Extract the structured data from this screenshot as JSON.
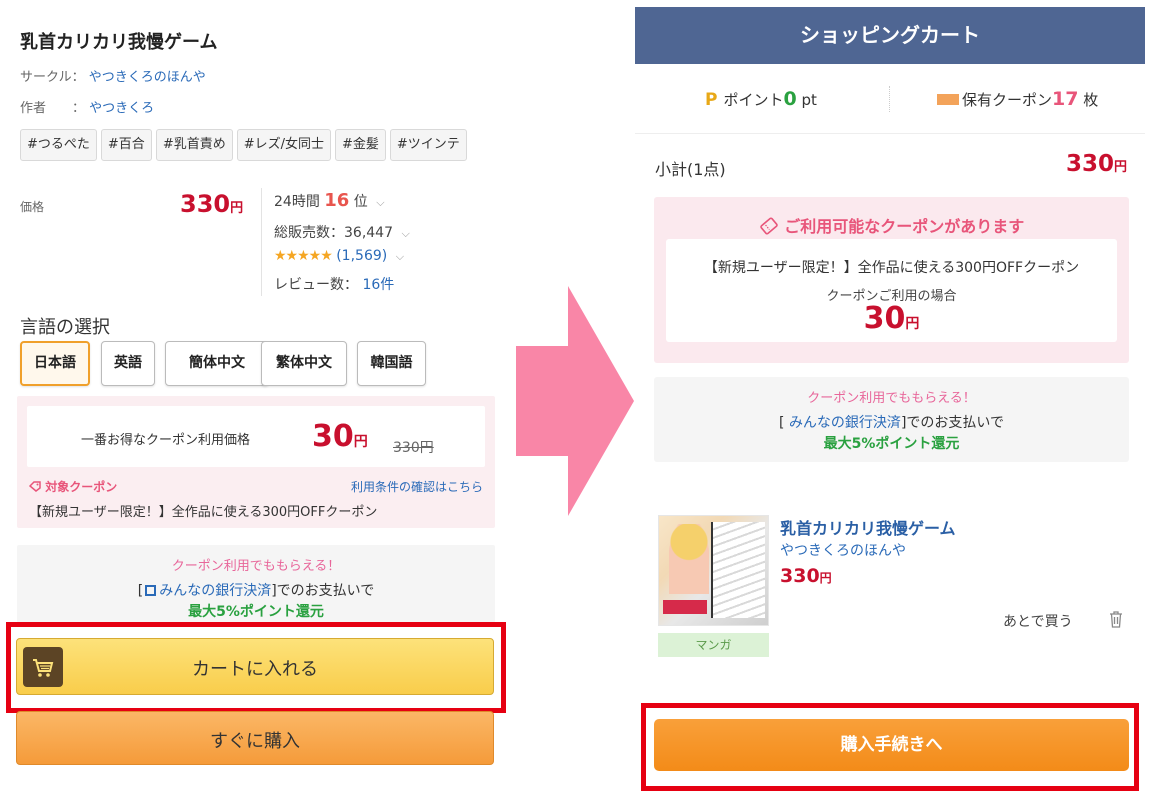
{
  "product": {
    "title": "乳首カリカリ我慢ゲーム",
    "circle_label": "サークル：",
    "circle": "やつきくろのほんや",
    "author_label": "作者　　：",
    "author": "やつきくろ",
    "tags": [
      "#つるぺた",
      "#百合",
      "#乳首責め",
      "#レズ/女同士",
      "#金髪",
      "#ツインテ"
    ],
    "price_label": "価格",
    "price": "330",
    "currency": "円",
    "rank_prefix": "24時間",
    "rank": "16",
    "rank_suffix": "位",
    "sales_text": "総販売数：36,447",
    "stars": "★★★★★",
    "rating_count": "(1,569)",
    "review_label": "レビュー数：",
    "review_count": "16件"
  },
  "language": {
    "heading": "言語の選択",
    "options": [
      "日本語",
      "英語",
      "簡体中文",
      "繁体中文",
      "韓国語"
    ],
    "selected": "日本語"
  },
  "coupon_left": {
    "label": "一番お得なクーポン利用価格",
    "price": "30",
    "currency": "円",
    "original": "330円",
    "target": "対象クーポン",
    "terms_link": "利用条件の確認はこちら",
    "description": "【新規ユーザー限定！】全作品に使える300円OFFクーポン"
  },
  "bank": {
    "line1": "クーポン利用でももらえる！",
    "bracket_open": "[",
    "bank_name": "みんなの銀行決済",
    "line2_suffix": "]でのお支払いで",
    "line3": "最大5%ポイント還元"
  },
  "buttons": {
    "add_to_cart": "カートに入れる",
    "buy_now": "すぐに購入"
  },
  "cart": {
    "header": "ショッピングカート",
    "points_prefix": "ポイント",
    "points_value": "0",
    "points_unit": "pt",
    "coupons_prefix": "保有クーポン",
    "coupons_value": "17",
    "coupons_unit": "枚",
    "subtotal_label": "小計(1点)",
    "subtotal": "330",
    "currency": "円",
    "coupon_available": "ご利用可能なクーポンがあります",
    "coupon_desc": "【新規ユーザー限定！】全作品に使える300円OFFクーポン",
    "coupon_use_label": "クーポンご利用の場合",
    "coupon_price": "30",
    "item_title": "乳首カリカリ我慢ゲーム",
    "item_circle": "やつきくろのほんや",
    "item_price": "330",
    "item_category": "マンガ",
    "later_label": "あとで買う",
    "proceed": "購入手続きへ"
  },
  "colors": {
    "price_red": "#c8102e",
    "header_blue": "#4f6693",
    "highlight_red": "#e60012",
    "arrow_pink": "#f986a7",
    "cart_yellow": "#f9cd4b",
    "buy_orange": "#f59b3a",
    "proceed_orange": "#f38b18",
    "point_green": "#2aa140"
  },
  "icons": {
    "cart_button": "cart-icon",
    "coupon": "ticket-icon",
    "trash": "trash-icon",
    "bank_window": "window-icon",
    "arrow": "right-arrow-icon"
  }
}
